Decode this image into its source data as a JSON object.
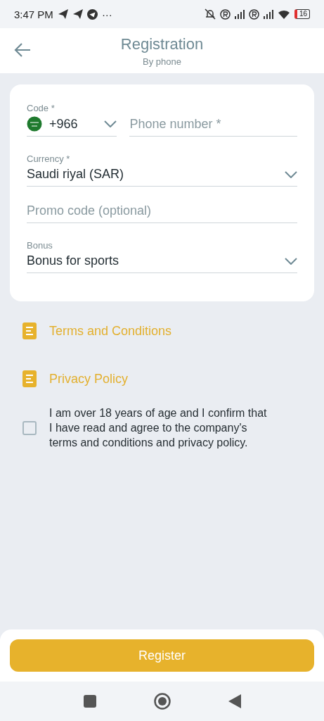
{
  "status_bar": {
    "time": "3:47 PM",
    "dots": "···",
    "battery": "16"
  },
  "header": {
    "title": "Registration",
    "subtitle": "By phone"
  },
  "form": {
    "code": {
      "label": "Code *",
      "value": "+966"
    },
    "phone": {
      "placeholder": "Phone number *"
    },
    "fields": [
      {
        "kind": "select",
        "label": "Currency *",
        "value": "Saudi riyal (SAR)"
      },
      {
        "kind": "input",
        "placeholder": "Promo code (optional)"
      },
      {
        "kind": "select",
        "label": "Bonus",
        "value": "Bonus for sports"
      }
    ]
  },
  "links": [
    "Terms and Conditions",
    "Privacy Policy"
  ],
  "agreement": {
    "checked": false,
    "text": "I am over 18 years of age and I confirm that I have read and agree to the company's terms and conditions and privacy policy."
  },
  "register_button": "Register"
}
